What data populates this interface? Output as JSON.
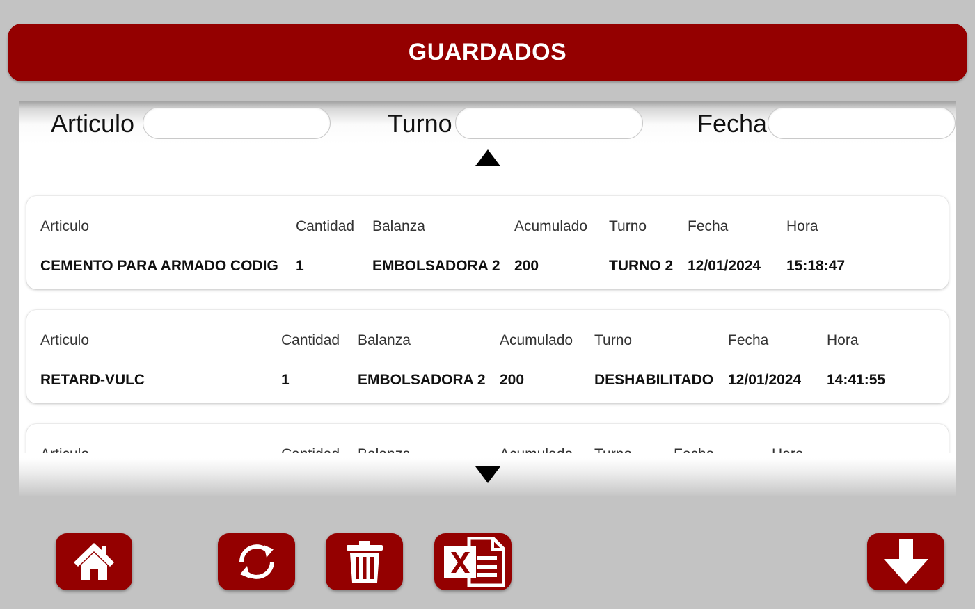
{
  "header": {
    "title": "GUARDADOS"
  },
  "filters": {
    "articulo_label": "Articulo",
    "articulo_value": "",
    "turno_label": "Turno",
    "turno_value": "",
    "fecha_label": "Fecha",
    "fecha_value": ""
  },
  "columns": [
    "Articulo",
    "Cantidad",
    "Balanza",
    "Acumulado",
    "Turno",
    "Fecha",
    "Hora"
  ],
  "records": [
    {
      "articulo": "CEMENTO PARA ARMADO CODIG",
      "cantidad": "1",
      "balanza": "EMBOLSADORA 2",
      "acumulado": "200",
      "turno": "TURNO 2",
      "fecha": "12/01/2024",
      "hora": "15:18:47"
    },
    {
      "articulo": "RETARD-VULC",
      "cantidad": "1",
      "balanza": "EMBOLSADORA 2",
      "acumulado": "200",
      "turno": "DESHABILITADO",
      "fecha": "12/01/2024",
      "hora": "14:41:55"
    }
  ],
  "toolbar": {
    "home_icon": "home-icon",
    "refresh_icon": "refresh-icon",
    "delete_icon": "trash-icon",
    "excel_icon": "excel-icon",
    "download_icon": "arrow-down-icon"
  },
  "colors": {
    "accent": "#940000",
    "background": "#c3c3c3"
  }
}
